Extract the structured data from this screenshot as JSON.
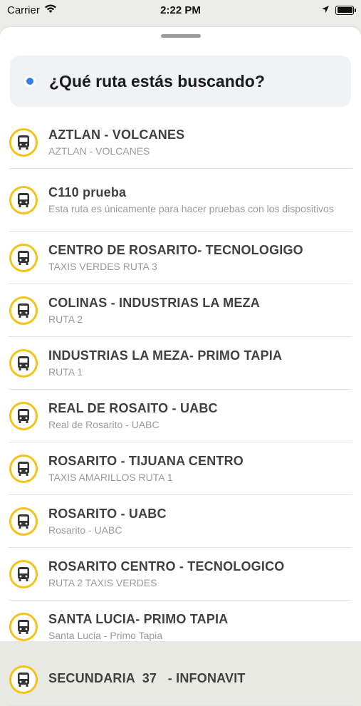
{
  "status_bar": {
    "carrier": "Carrier",
    "time": "2:22 PM"
  },
  "search": {
    "prompt": "¿Qué ruta estás buscando?",
    "dot_color": "#2f80ed"
  },
  "accent_color": "#f3c318",
  "routes": [
    {
      "title": "AZTLAN - VOLCANES",
      "subtitle": "AZTLAN - VOLCANES"
    },
    {
      "title": "C110 prueba",
      "subtitle": "Esta ruta es únicamente para hacer pruebas con los dispositivos"
    },
    {
      "title": "CENTRO DE ROSARITO- TECNOLOGIGO",
      "subtitle": "TAXIS VERDES RUTA 3"
    },
    {
      "title": "COLINAS - INDUSTRIAS LA MEZA",
      "subtitle": "RUTA 2"
    },
    {
      "title": "INDUSTRIAS LA MEZA- PRIMO TAPIA",
      "subtitle": "RUTA 1"
    },
    {
      "title": "REAL DE ROSAITO - UABC",
      "subtitle": "Real de Rosarito - UABC"
    },
    {
      "title": "ROSARITO - TIJUANA CENTRO",
      "subtitle": "TAXIS AMARILLOS RUTA 1"
    },
    {
      "title": "ROSARITO - UABC",
      "subtitle": "Rosarito - UABC"
    },
    {
      "title": "ROSARITO CENTRO - TECNOLOGICO",
      "subtitle": "RUTA 2 TAXIS VERDES"
    },
    {
      "title": "SANTA LUCIA- PRIMO TAPIA",
      "subtitle": "Santa Lucia - Primo Tapia"
    },
    {
      "title": "SECUNDARIA  37   - INFONAVIT",
      "subtitle": ""
    }
  ]
}
